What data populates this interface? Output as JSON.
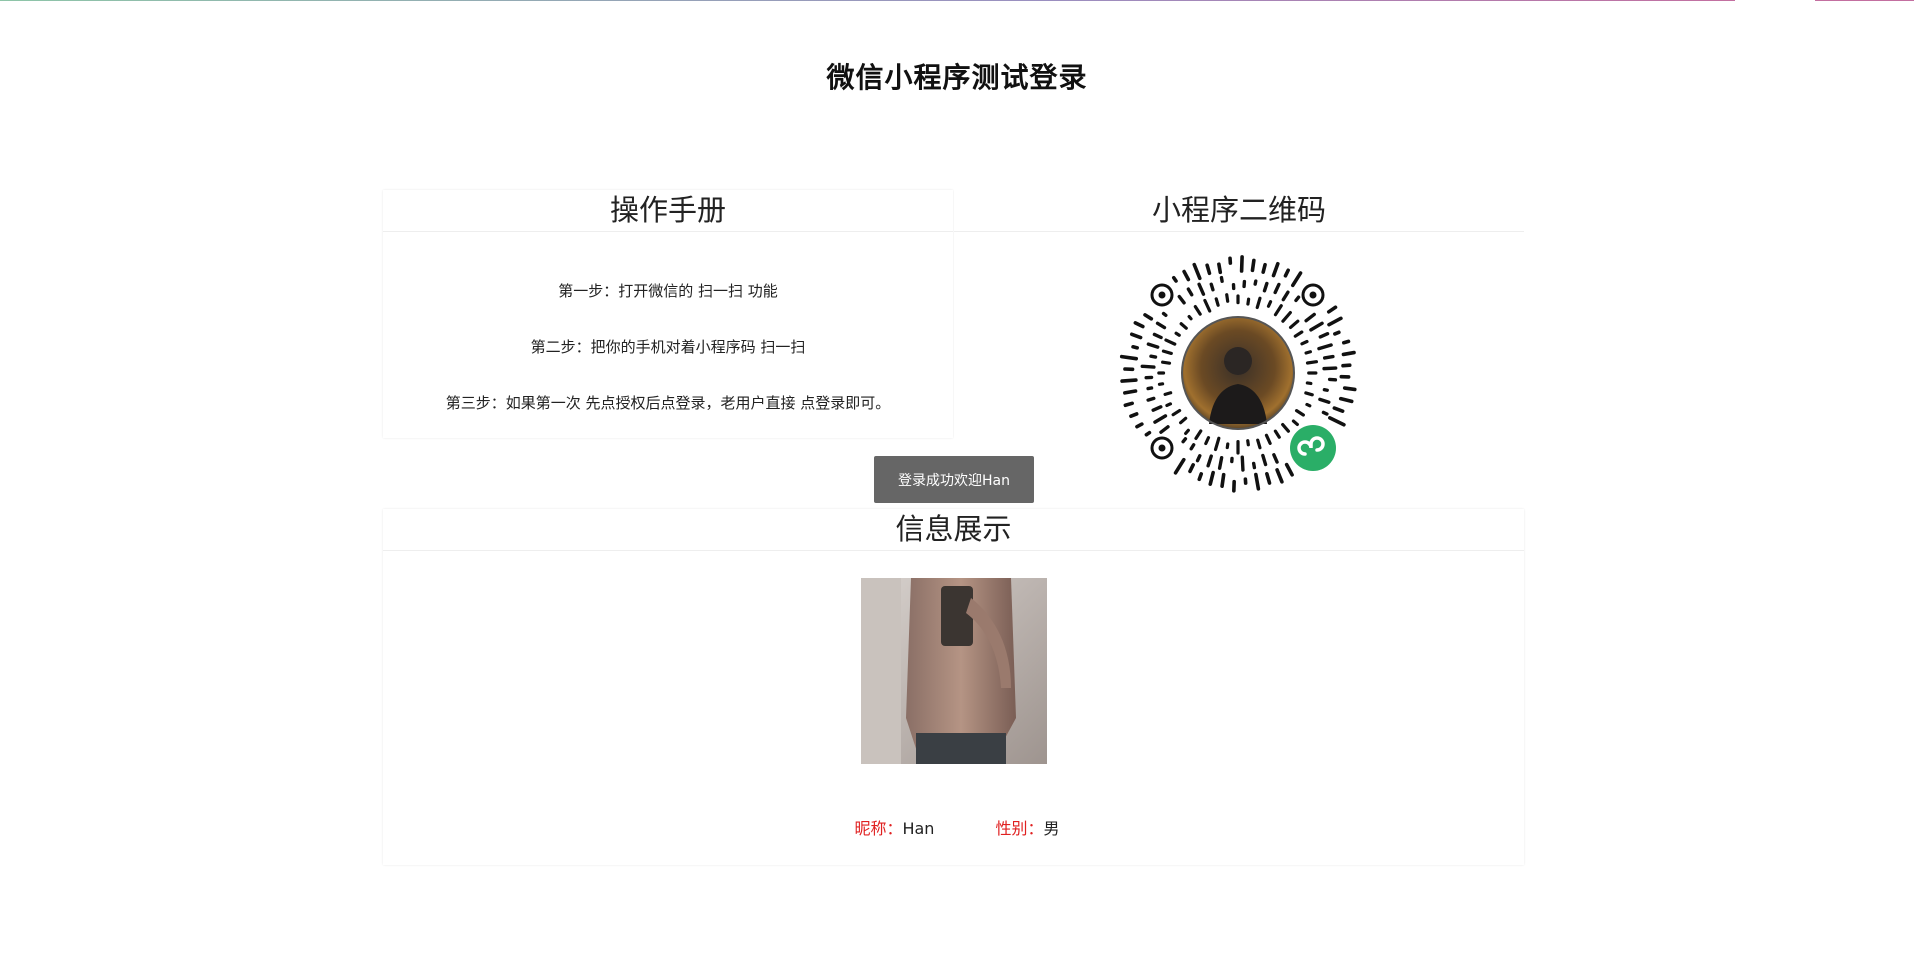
{
  "page": {
    "title": "微信小程序测试登录"
  },
  "manual": {
    "heading": "操作手册",
    "steps": [
      "第一步：打开微信的 扫一扫 功能",
      "第二步：把你的手机对着小程序码 扫一扫",
      "第三步：如果第一次 先点授权后点登录，老用户直接 点登录即可。"
    ]
  },
  "qr": {
    "heading": "小程序二维码",
    "icon": "wechat-miniprogram-logo",
    "badge_color": "#2aae67"
  },
  "login_button": {
    "label": "登录成功欢迎Han"
  },
  "info": {
    "heading": "信息展示",
    "nickname_label": "昵称：",
    "nickname_value": "Han",
    "gender_label": "性别：",
    "gender_value": "男",
    "label_color": "#e02020"
  }
}
